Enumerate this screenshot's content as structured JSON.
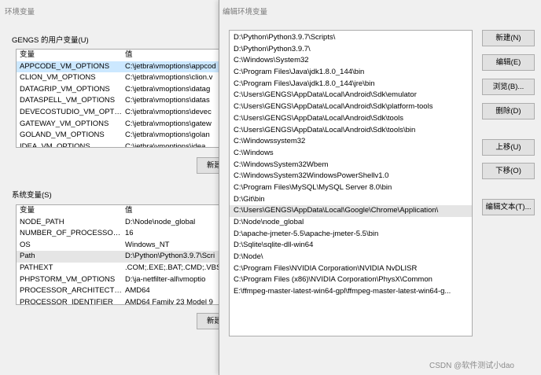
{
  "env_window": {
    "title": "环境变量",
    "user_group_label": "GENGS 的用户变量(U)",
    "user_header": {
      "name": "变量",
      "value": "值"
    },
    "user_vars": [
      {
        "name": "APPCODE_VM_OPTIONS",
        "value": "C:\\jetbra\\vmoptions\\appcod"
      },
      {
        "name": "CLION_VM_OPTIONS",
        "value": "C:\\jetbra\\vmoptions\\clion.v"
      },
      {
        "name": "DATAGRIP_VM_OPTIONS",
        "value": "C:\\jetbra\\vmoptions\\datag"
      },
      {
        "name": "DATASPELL_VM_OPTIONS",
        "value": "C:\\jetbra\\vmoptions\\datas"
      },
      {
        "name": "DEVECOSTUDIO_VM_OPTI...",
        "value": "C:\\jetbra\\vmoptions\\devec"
      },
      {
        "name": "GATEWAY_VM_OPTIONS",
        "value": "C:\\jetbra\\vmoptions\\gatew"
      },
      {
        "name": "GOLAND_VM_OPTIONS",
        "value": "C:\\jetbra\\vmoptions\\golan"
      },
      {
        "name": "IDEA_VM_OPTIONS",
        "value": "C:\\jetbra\\vmoptions\\idea"
      }
    ],
    "user_new_button": "新建",
    "system_group_label": "系统变量(S)",
    "system_header": {
      "name": "变量",
      "value": "值"
    },
    "system_vars": [
      {
        "name": "NODE_PATH",
        "value": "D:\\Node\\node_global"
      },
      {
        "name": "NUMBER_OF_PROCESSORS",
        "value": "16"
      },
      {
        "name": "OS",
        "value": "Windows_NT"
      },
      {
        "name": "Path",
        "value": "D:\\Python\\Python3.9.7\\Scri"
      },
      {
        "name": "PATHEXT",
        "value": ".COM;.EXE;.BAT;.CMD;.VBS"
      },
      {
        "name": "PHPSTORM_VM_OPTIONS",
        "value": "D:\\ja-netfilter-all\\vmoptio"
      },
      {
        "name": "PROCESSOR_ARCHITECTURE",
        "value": "AMD64"
      },
      {
        "name": "PROCESSOR_IDENTIFIER",
        "value": "AMD64 Family 23 Model 9"
      }
    ],
    "system_new_button": "新建"
  },
  "edit_window": {
    "title": "编辑环境变量",
    "paths": [
      "D:\\Python\\Python3.9.7\\Scripts\\",
      "D:\\Python\\Python3.9.7\\",
      "C:\\Windows\\System32",
      "C:\\Program Files\\Java\\jdk1.8.0_144\\bin",
      "C:\\Program Files\\Java\\jdk1.8.0_144\\jre\\bin",
      "C:\\Users\\GENGS\\AppData\\Local\\Android\\Sdk\\emulator",
      "C:\\Users\\GENGS\\AppData\\Local\\Android\\Sdk\\platform-tools",
      "C:\\Users\\GENGS\\AppData\\Local\\Android\\Sdk\\tools",
      "C:\\Users\\GENGS\\AppData\\Local\\Android\\Sdk\\tools\\bin",
      "C:\\Windowssystem32",
      "C:\\Windows",
      "C:\\WindowsSystem32Wbem",
      "C:\\WindowsSystem32WindowsPowerShellv1.0",
      "C:\\Program Files\\MySQL\\MySQL Server 8.0\\bin",
      "D:\\Git\\bin",
      "C:\\Users\\GENGS\\AppData\\Local\\Google\\Chrome\\Application\\",
      "D:\\Node\\node_global",
      "D:\\apache-jmeter-5.5\\apache-jmeter-5.5\\bin",
      "D:\\Sqlite\\sqlite-dll-win64",
      "D:\\Node\\",
      "C:\\Program Files\\NVIDIA Corporation\\NVIDIA NvDLISR",
      "C:\\Program Files (x86)\\NVIDIA Corporation\\PhysX\\Common",
      "E:\\ffmpeg-master-latest-win64-gpl\\ffmpeg-master-latest-win64-g..."
    ],
    "buttons": {
      "new": "新建(N)",
      "edit": "编辑(E)",
      "browse": "浏览(B)...",
      "delete": "删除(D)",
      "move_up": "上移(U)",
      "move_down": "下移(O)",
      "edit_text": "编辑文本(T)..."
    }
  },
  "watermark": "CSDN @软件测试小dao"
}
